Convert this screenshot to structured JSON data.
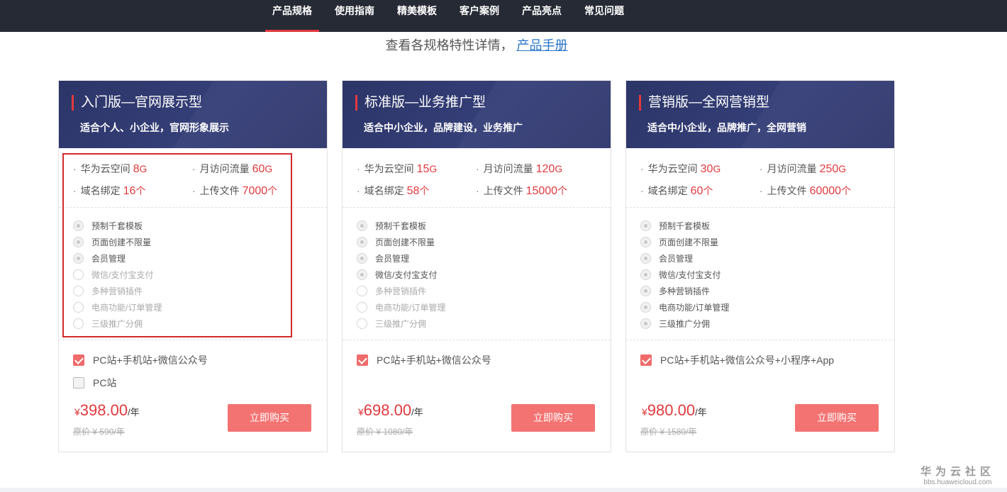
{
  "nav": {
    "tabs": [
      {
        "label": "产品规格",
        "active": true
      },
      {
        "label": "使用指南"
      },
      {
        "label": "精美模板"
      },
      {
        "label": "客户案例"
      },
      {
        "label": "产品亮点"
      },
      {
        "label": "常见问题"
      }
    ]
  },
  "subtitle": {
    "text": "查看各规格特性详情，",
    "link": "产品手册"
  },
  "colors": {
    "accent": "#e0393e",
    "header_bg": "#2c3567",
    "button": "#f37372",
    "nav_bg": "#262a35"
  },
  "plans": [
    {
      "name": "入门版—官网展示型",
      "desc": "适合个人、小企业，官网形象展示",
      "specs": {
        "storage": {
          "label": "华为云空间",
          "value": "8",
          "unit": "G"
        },
        "traffic": {
          "label": "月访问流量",
          "value": "60",
          "unit": "G"
        },
        "domains": {
          "label": "域名绑定",
          "value": "16",
          "unit": "个"
        },
        "uploads": {
          "label": "上传文件",
          "value": "7000",
          "unit": "个"
        }
      },
      "features": [
        {
          "label": "预制千套模板",
          "on": true
        },
        {
          "label": "页面创建不限量",
          "on": true
        },
        {
          "label": "会员管理",
          "on": true
        },
        {
          "label": "微信/支付宝支付",
          "on": false
        },
        {
          "label": "多种营销插件",
          "on": false
        },
        {
          "label": "电商功能/订单管理",
          "on": false
        },
        {
          "label": "三级推广分佣",
          "on": false
        }
      ],
      "options": [
        {
          "label": "PC站+手机站+微信公众号",
          "checked": true
        },
        {
          "label": "PC站",
          "checked": false
        }
      ],
      "price": {
        "currency": "¥",
        "amount": "398.00",
        "per": "/年",
        "original": "原价 ¥ 590/年"
      },
      "buy_label": "立即购买"
    },
    {
      "name": "标准版—业务推广型",
      "desc": "适合中小企业，品牌建设，业务推广",
      "specs": {
        "storage": {
          "label": "华为云空间",
          "value": "15",
          "unit": "G"
        },
        "traffic": {
          "label": "月访问流量",
          "value": "120",
          "unit": "G"
        },
        "domains": {
          "label": "域名绑定",
          "value": "58",
          "unit": "个"
        },
        "uploads": {
          "label": "上传文件",
          "value": "15000",
          "unit": "个"
        }
      },
      "features": [
        {
          "label": "预制千套模板",
          "on": true
        },
        {
          "label": "页面创建不限量",
          "on": true
        },
        {
          "label": "会员管理",
          "on": true
        },
        {
          "label": "微信/支付宝支付",
          "on": true
        },
        {
          "label": "多种营销插件",
          "on": false
        },
        {
          "label": "电商功能/订单管理",
          "on": false
        },
        {
          "label": "三级推广分佣",
          "on": false
        }
      ],
      "options": [
        {
          "label": "PC站+手机站+微信公众号",
          "checked": true
        }
      ],
      "price": {
        "currency": "¥",
        "amount": "698.00",
        "per": "/年",
        "original": "原价 ¥ 1080/年"
      },
      "buy_label": "立即购买"
    },
    {
      "name": "营销版—全网营销型",
      "desc": "适合中小企业，品牌推广，全网营销",
      "specs": {
        "storage": {
          "label": "华为云空间",
          "value": "30",
          "unit": "G"
        },
        "traffic": {
          "label": "月访问流量",
          "value": "250",
          "unit": "G"
        },
        "domains": {
          "label": "域名绑定",
          "value": "60",
          "unit": "个"
        },
        "uploads": {
          "label": "上传文件",
          "value": "60000",
          "unit": "个"
        }
      },
      "features": [
        {
          "label": "预制千套模板",
          "on": true
        },
        {
          "label": "页面创建不限量",
          "on": true
        },
        {
          "label": "会员管理",
          "on": true
        },
        {
          "label": "微信/支付宝支付",
          "on": true
        },
        {
          "label": "多种营销插件",
          "on": true
        },
        {
          "label": "电商功能/订单管理",
          "on": true
        },
        {
          "label": "三级推广分佣",
          "on": true
        }
      ],
      "options": [
        {
          "label": "PC站+手机站+微信公众号+小程序+App",
          "checked": true
        }
      ],
      "price": {
        "currency": "¥",
        "amount": "980.00",
        "per": "/年",
        "original": "原价 ¥ 1580/年"
      },
      "buy_label": "立即购买"
    }
  ],
  "watermark": {
    "line1": "华为云社区",
    "line2": "bbs.huaweicloud.com"
  }
}
